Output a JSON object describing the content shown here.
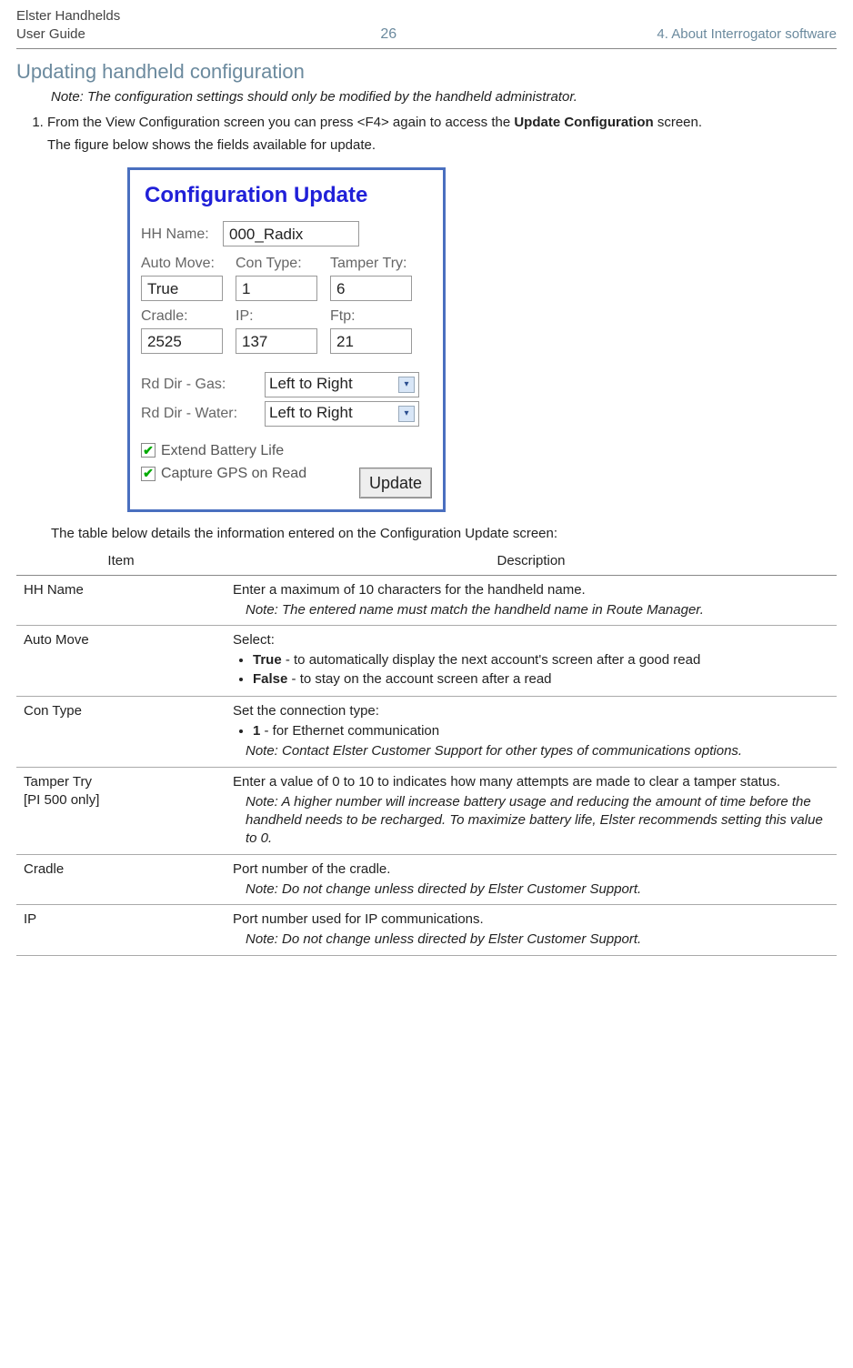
{
  "header": {
    "left_line1": "Elster Handhelds",
    "left_line2": "User Guide",
    "page_number": "26",
    "right": "4. About Interrogator software"
  },
  "section_heading": "Updating handheld configuration",
  "note_text": "Note: The configuration settings should only be modified by the handheld administrator.",
  "step1_prefix": "From the View Configuration screen you can press <F4> again to access the ",
  "step1_bold": "Update Configuration",
  "step1_suffix": " screen.",
  "step1_body2": "The figure below shows the fields available for update.",
  "screenshot": {
    "title": "Configuration Update",
    "hh_name_label": "HH Name:",
    "hh_name_value": "000_Radix",
    "auto_move_label": "Auto Move:",
    "auto_move_value": "True",
    "con_type_label": "Con Type:",
    "con_type_value": "1",
    "tamper_try_label": "Tamper Try:",
    "tamper_try_value": "6",
    "cradle_label": "Cradle:",
    "cradle_value": "2525",
    "ip_label": "IP:",
    "ip_value": "137",
    "ftp_label": "Ftp:",
    "ftp_value": "21",
    "rd_gas_label": "Rd Dir - Gas:",
    "rd_gas_value": "Left to Right",
    "rd_water_label": "Rd Dir - Water:",
    "rd_water_value": "Left to Right",
    "chk_batt": "Extend Battery Life",
    "chk_gps": "Capture GPS on Read",
    "update_btn": "Update"
  },
  "after_shot_text": "The table below details the information entered on the Configuration Update screen:",
  "table": {
    "col1": "Item",
    "col2": "Description",
    "rows": {
      "hh_name": {
        "item": "HH Name",
        "desc": "Enter a maximum of 10 characters for the handheld name.",
        "note": "Note: The entered name must match the handheld name in Route Manager."
      },
      "auto_move": {
        "item": "Auto Move",
        "desc": "Select:",
        "b1_bold": "True",
        "b1_rest": " - to automatically display the next account's screen after a good read",
        "b2_bold": "False",
        "b2_rest": " - to stay on the account screen after a read"
      },
      "con_type": {
        "item": "Con Type",
        "desc": "Set the connection type:",
        "b1_bold": "1",
        "b1_rest": " - for Ethernet communication",
        "note": "Note: Contact Elster Customer Support for other types of communications options."
      },
      "tamper": {
        "item": "Tamper Try",
        "item2": "[PI 500 only]",
        "desc": "Enter a value of 0 to 10 to indicates how many attempts are made to clear a tamper status.",
        "note": "Note: A higher number will increase battery usage and reducing the amount of time before the handheld needs to be recharged. To maximize battery life, Elster recommends setting this value to 0."
      },
      "cradle": {
        "item": "Cradle",
        "desc": "Port number of the cradle.",
        "note": "Note: Do not change unless directed by Elster Customer Support."
      },
      "ip": {
        "item": "IP",
        "desc": "Port number used for IP communications.",
        "note": "Note: Do not change unless directed by Elster Customer Support."
      }
    }
  }
}
